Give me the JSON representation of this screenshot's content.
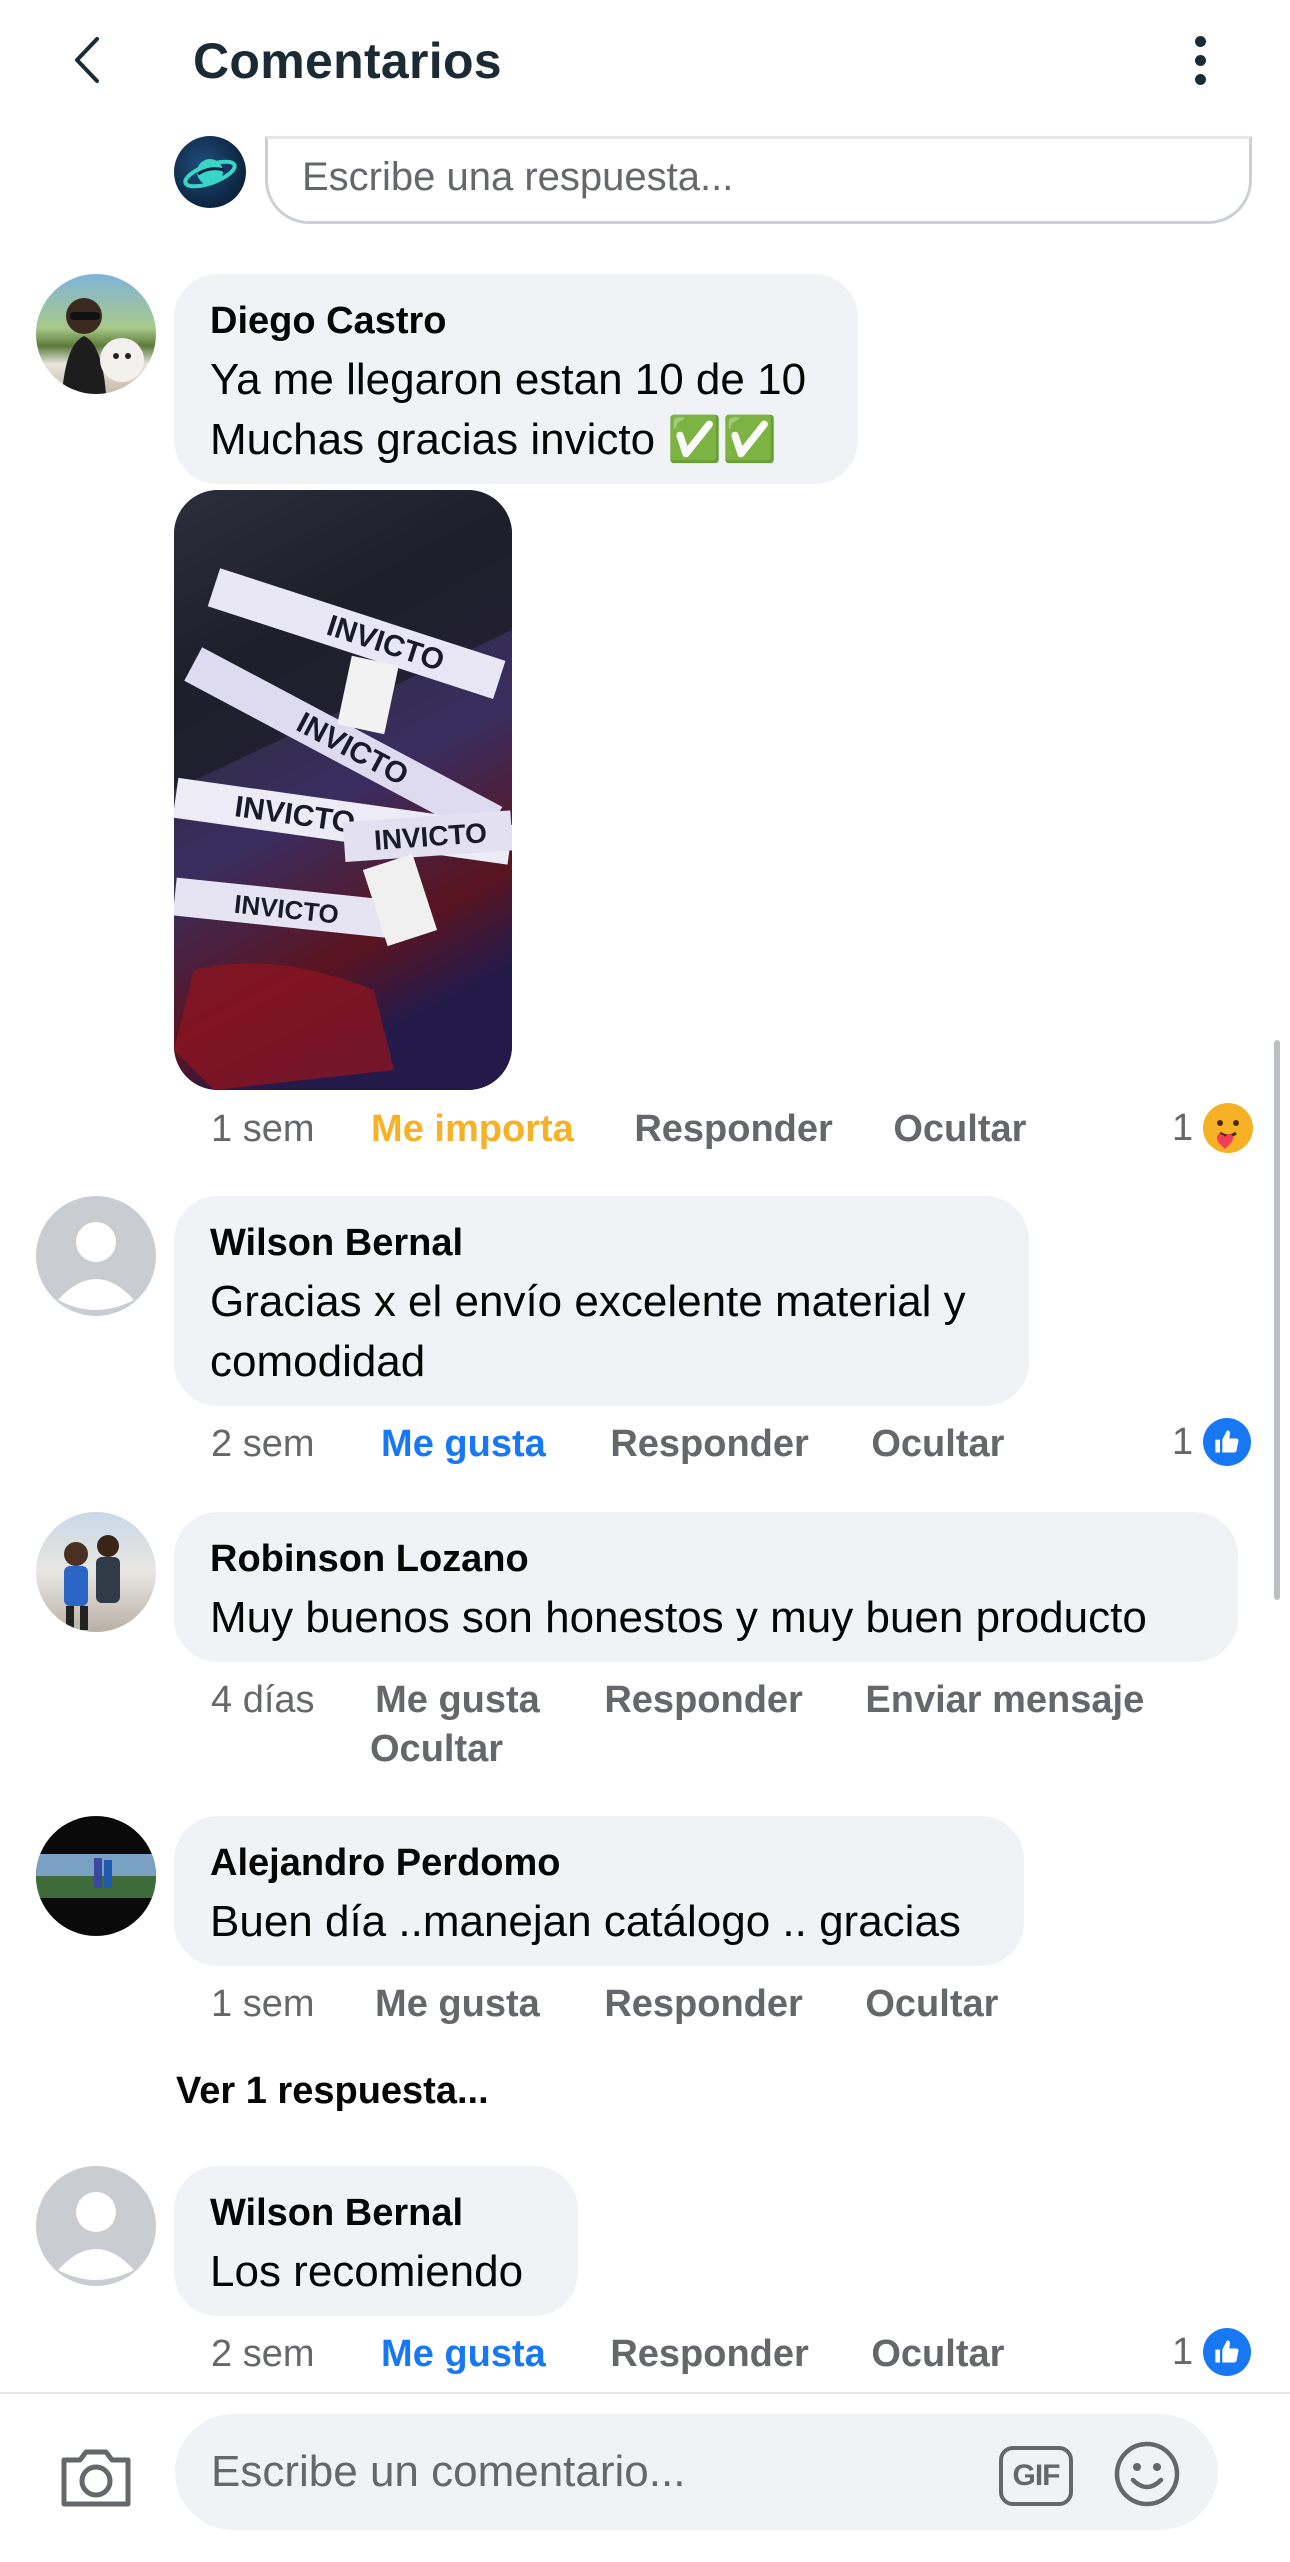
{
  "header": {
    "title": "Comentarios"
  },
  "reply": {
    "placeholder": "Escribe una respuesta..."
  },
  "comments": [
    {
      "author": "Diego Castro",
      "lines": [
        "Ya me llegaron estan 10 de 10",
        "Muchas gracias invicto ✅✅"
      ],
      "time": "1 sem",
      "reaction_label": "Me importa",
      "reply_label": "Responder",
      "hide_label": "Ocultar",
      "reaction_count": "1"
    },
    {
      "author": "Wilson Bernal",
      "lines": [
        "Gracias x el envío excelente material y",
        "comodidad"
      ],
      "time": "2 sem",
      "reaction_label": "Me gusta",
      "reply_label": "Responder",
      "hide_label": "Ocultar",
      "reaction_count": "1"
    },
    {
      "author": "Robinson Lozano",
      "lines": [
        "Muy buenos son honestos y muy buen producto"
      ],
      "time": "4 días",
      "reaction_label": "Me gusta",
      "reply_label": "Responder",
      "message_label": "Enviar mensaje",
      "hide_label": "Ocultar"
    },
    {
      "author": "Alejandro Perdomo",
      "lines": [
        "Buen día ..manejan catálogo .. gracias"
      ],
      "time": "1 sem",
      "reaction_label": "Me gusta",
      "reply_label": "Responder",
      "hide_label": "Ocultar",
      "view_replies": "Ver 1 respuesta..."
    },
    {
      "author": "Wilson Bernal",
      "lines": [
        "Los recomiendo"
      ],
      "time": "2 sem",
      "reaction_label": "Me gusta",
      "reply_label": "Responder",
      "hide_label": "Ocultar",
      "reaction_count": "1"
    }
  ],
  "image_text": [
    "INVICTO",
    "INVICTO",
    "INVICTO",
    "INVICTO",
    "INVICTO"
  ],
  "composer": {
    "placeholder": "Escribe un comentario...",
    "gif_label": "GIF"
  },
  "icons": {
    "back": "chevron-left-icon",
    "more": "more-vertical-icon",
    "camera": "camera-icon",
    "gif": "gif-icon",
    "emoji": "smiley-icon",
    "like": "thumbs-up-icon",
    "care": "care-reaction-icon"
  },
  "colors": {
    "like_blue": "#1877f2",
    "care_yellow": "#f7b125",
    "bubble_bg": "#f0f2f5",
    "meta_gray": "#65676b"
  }
}
